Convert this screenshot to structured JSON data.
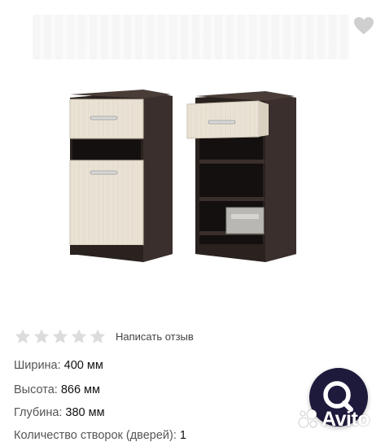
{
  "colors": {
    "wenge": "#3a2f2c",
    "wenge_dark": "#2a221f",
    "light_wood": "#ebe4d6",
    "star_gray": "#dcdcdc",
    "fab_bg": "#1e1a3c"
  },
  "icons": {
    "favorite": "heart-icon",
    "star": "star-icon",
    "fab": "search-magnifier-icon",
    "brand": "avito-logo"
  },
  "rating": {
    "stars_filled": 0,
    "stars_total": 5,
    "review_label": "Написать отзыв"
  },
  "specs": [
    {
      "label": "Ширина:",
      "value": "400 мм"
    },
    {
      "label": "Высота:",
      "value": "866 мм"
    },
    {
      "label": "Глубина:",
      "value": "380 мм"
    },
    {
      "label": "Количество створок (дверей):",
      "value": "1"
    }
  ],
  "watermark": {
    "brand_text": "Avito"
  }
}
